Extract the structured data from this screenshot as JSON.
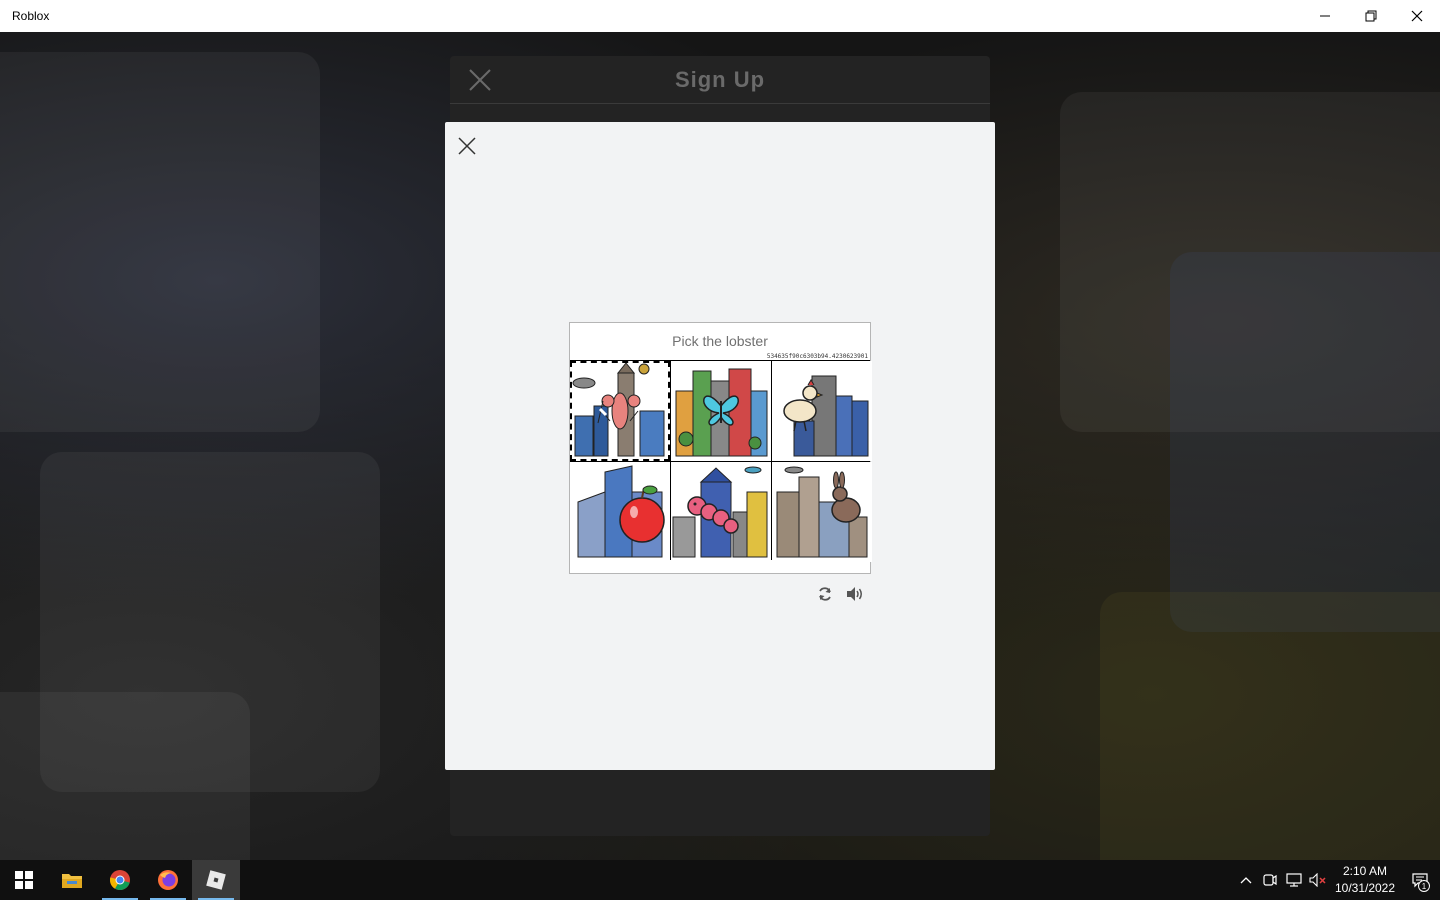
{
  "window": {
    "title": "Roblox",
    "controls": [
      "minimize-icon",
      "restore-icon",
      "close-icon"
    ]
  },
  "signup": {
    "title": "Sign Up"
  },
  "captcha": {
    "prompt": "Pick the lobster",
    "challenge_id": "534635f90c6303b94.4230623901",
    "tiles": [
      {
        "subject": "lobster",
        "selected": true
      },
      {
        "subject": "butterfly",
        "selected": false
      },
      {
        "subject": "chicken",
        "selected": false
      },
      {
        "subject": "apple",
        "selected": false
      },
      {
        "subject": "caterpillar",
        "selected": false
      },
      {
        "subject": "rabbit",
        "selected": false
      }
    ],
    "tools": [
      "refresh-icon",
      "audio-icon"
    ]
  },
  "taskbar": {
    "apps": [
      "windows-start-icon",
      "file-explorer-icon",
      "chrome-icon",
      "firefox-icon",
      "roblox-icon"
    ],
    "active_app": "roblox-icon",
    "tray_icons": [
      "chevron-up-icon",
      "meet-now-icon",
      "network-icon",
      "volume-muted-icon"
    ],
    "clock_time": "2:10 AM",
    "clock_date": "10/31/2022",
    "notification_count": "1"
  },
  "colors": {
    "accent": "#76b9ed",
    "modal_bg": "#f2f3f4",
    "prompt_text": "#707070"
  }
}
